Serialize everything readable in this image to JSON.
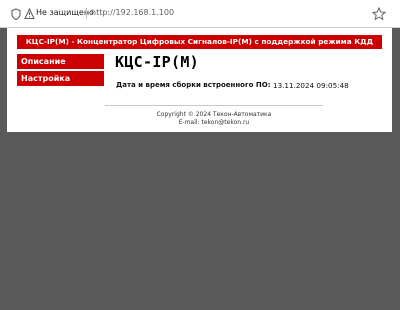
{
  "browser": {
    "not_secure_label": "Не защищено",
    "url": "http://192.168.1.100"
  },
  "page": {
    "banner": "КЦС-IP(М) - Концентратор Цифровых Сигналов-IP(М) с поддержкой режима КДД",
    "menu": [
      {
        "label": "Описание"
      },
      {
        "label": "Настройка"
      }
    ],
    "title": "КЦС-IP(М)",
    "firmware_label": "Дата и время сборки встроенного ПО:",
    "firmware_value": "13.11.2024 09:05:48",
    "copyright": "Copyright © 2024 Текон-Автоматика",
    "email": "E-mail: tekon@tekon.ru"
  },
  "colors": {
    "accent": "#cc0000",
    "outside": "#595959"
  }
}
